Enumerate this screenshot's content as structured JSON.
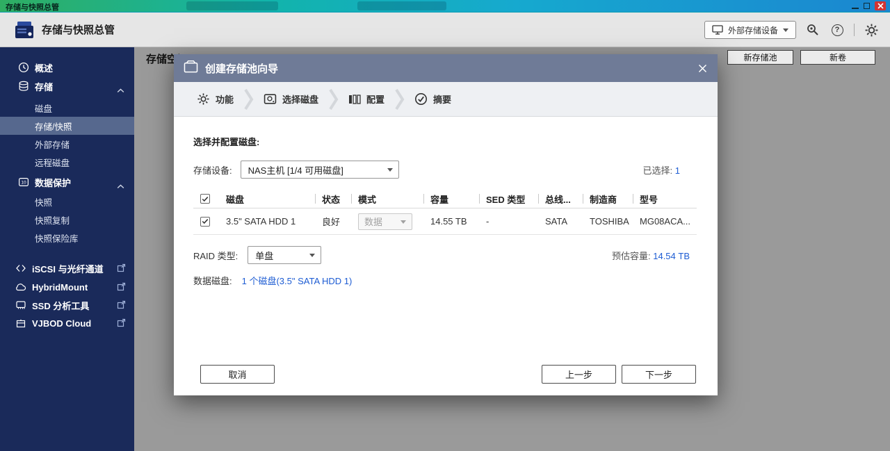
{
  "taskbar": {
    "title": "存储与快照总管"
  },
  "header": {
    "app_title": "存储与快照总管",
    "external_device_button": "外部存储设备"
  },
  "sidebar": {
    "items": [
      {
        "label": "概述"
      },
      {
        "label": "存储"
      },
      {
        "label": "磁盘"
      },
      {
        "label": "存储/快照"
      },
      {
        "label": "外部存储"
      },
      {
        "label": "远程磁盘"
      },
      {
        "label": "数据保护"
      },
      {
        "label": "快照"
      },
      {
        "label": "快照复制"
      },
      {
        "label": "快照保险库"
      },
      {
        "label": "iSCSI 与光纤通道"
      },
      {
        "label": "HybridMount"
      },
      {
        "label": "SSD 分析工具"
      },
      {
        "label": "VJBOD Cloud"
      }
    ]
  },
  "main": {
    "page_title": "存储空间",
    "new_pool_button": "新存储池",
    "new_volume_button": "新卷"
  },
  "modal": {
    "title": "创建存储池向导",
    "steps": [
      {
        "label": "功能"
      },
      {
        "label": "选择磁盘"
      },
      {
        "label": "配置"
      },
      {
        "label": "摘要"
      }
    ],
    "section_title": "选择并配置磁盘:",
    "device_label": "存储设备:",
    "device_value": "NAS主机 [1/4 可用磁盘]",
    "selected_label": "已选择:",
    "selected_count": "1",
    "table": {
      "headers": [
        "磁盘",
        "状态",
        "模式",
        "容量",
        "SED 类型",
        "总线...",
        "制造商",
        "型号"
      ],
      "rows": [
        {
          "disk": "3.5\" SATA HDD 1",
          "status": "良好",
          "mode": "数据",
          "capacity": "14.55 TB",
          "sed_type": "-",
          "bus": "SATA",
          "manufacturer": "TOSHIBA",
          "model": "MG08ACA..."
        }
      ]
    },
    "raid_label": "RAID 类型:",
    "raid_value": "单盘",
    "estimated_label": "预估容量:",
    "estimated_value": "14.54 TB",
    "data_disks_label": "数据磁盘:",
    "data_disks_link": "1 个磁盘(3.5\" SATA HDD 1)",
    "footer": {
      "cancel": "取消",
      "previous": "上一步",
      "next": "下一步"
    }
  },
  "colors": {
    "accent_blue": "#1d5cd3",
    "sidebar_bg": "#1a2a5a",
    "sidebar_selected_bg": "#56688e",
    "modal_header_bg": "#6f7b97",
    "close_button_red": "#d23333",
    "taskbar_gradient": [
      "#2fae62",
      "#12b4ab",
      "#1b86d0"
    ]
  }
}
